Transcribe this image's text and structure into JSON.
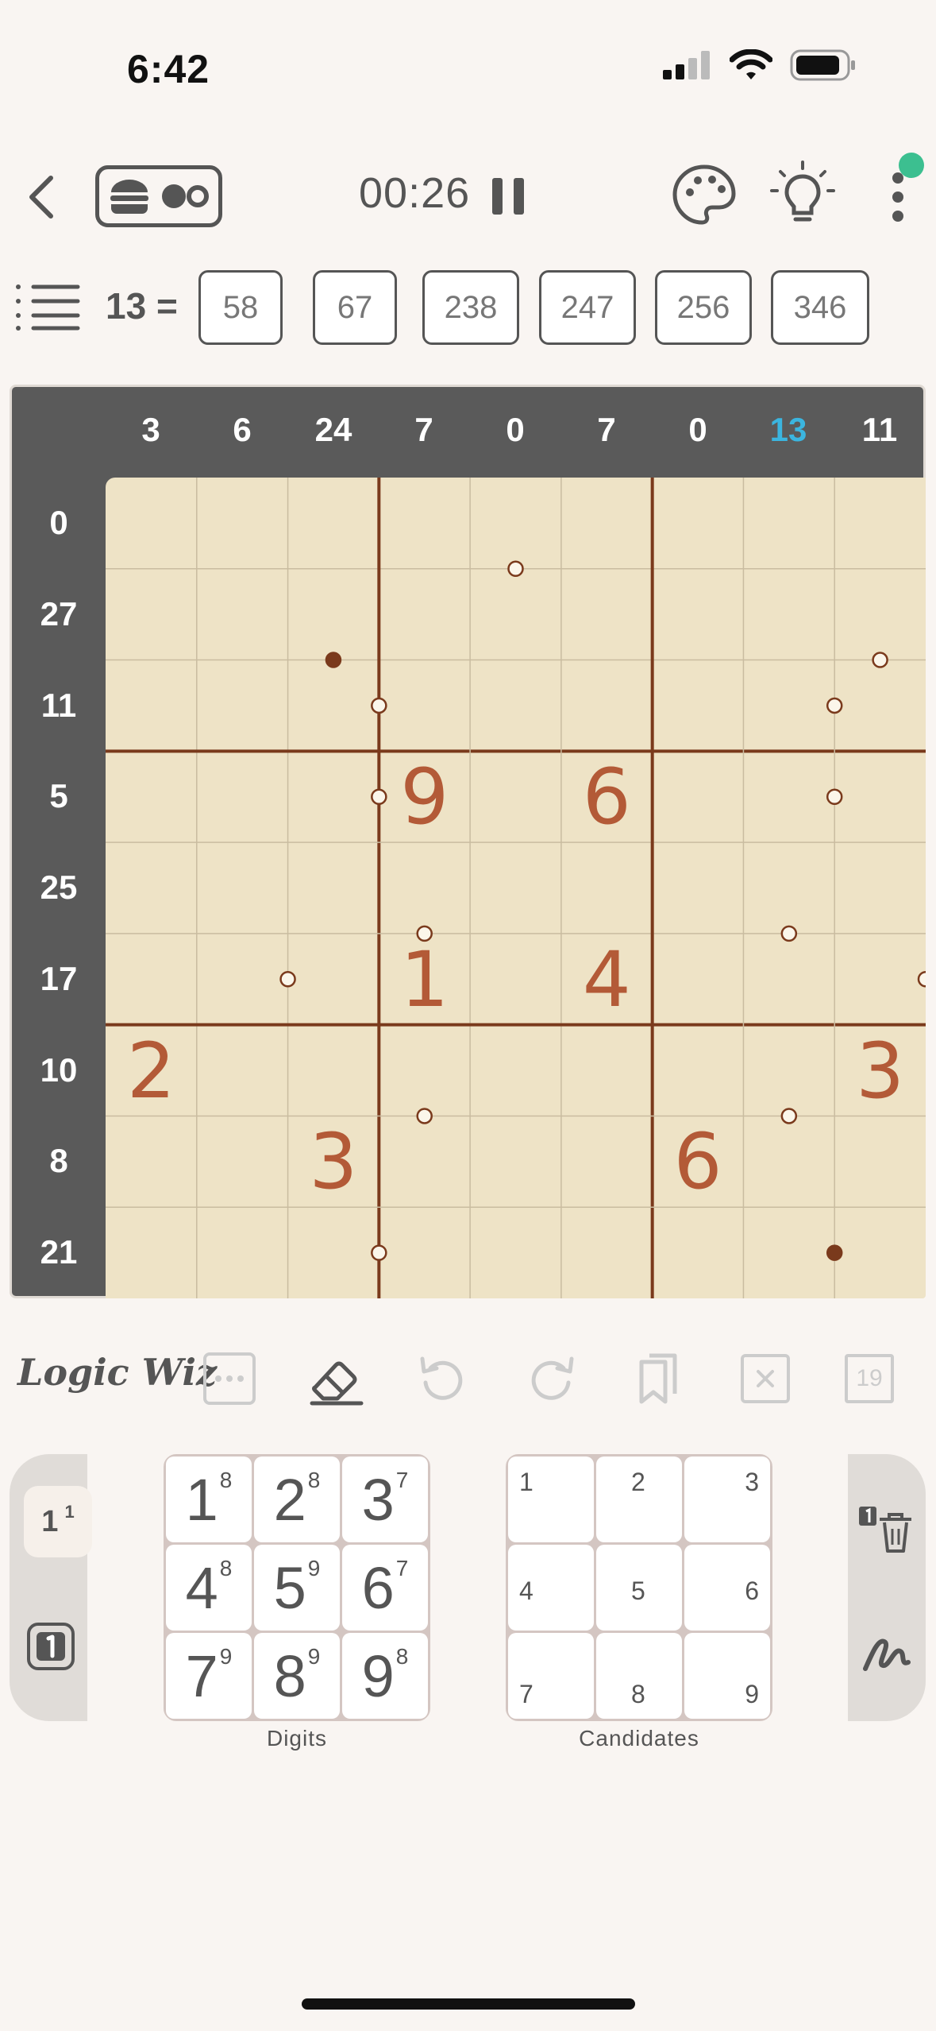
{
  "status": {
    "time": "6:42"
  },
  "header": {
    "timer": "00:26"
  },
  "sum_strip": {
    "label": "13 =",
    "combos": [
      "58",
      "67",
      "238",
      "247",
      "256",
      "346"
    ]
  },
  "board": {
    "col_clues": [
      "3",
      "6",
      "24",
      "7",
      "0",
      "7",
      "0",
      "13",
      "11"
    ],
    "row_clues": [
      "0",
      "27",
      "11",
      "5",
      "25",
      "17",
      "10",
      "8",
      "21"
    ],
    "highlight_col": 7,
    "givens": [
      {
        "row": 3,
        "col": 3,
        "value": "9"
      },
      {
        "row": 3,
        "col": 5,
        "value": "6"
      },
      {
        "row": 5,
        "col": 3,
        "value": "1"
      },
      {
        "row": 5,
        "col": 5,
        "value": "4"
      },
      {
        "row": 6,
        "col": 0,
        "value": "2"
      },
      {
        "row": 6,
        "col": 8,
        "value": "3"
      },
      {
        "row": 7,
        "col": 2,
        "value": "3"
      },
      {
        "row": 7,
        "col": 6,
        "value": "6"
      }
    ],
    "dots": [
      {
        "r": 1,
        "c": 4.5,
        "filled": false
      },
      {
        "r": 2,
        "c": 2.5,
        "filled": true
      },
      {
        "r": 2,
        "c": 8.5,
        "filled": false
      },
      {
        "r": 2.5,
        "c": 3,
        "filled": false
      },
      {
        "r": 2.5,
        "c": 8,
        "filled": false
      },
      {
        "r": 3.5,
        "c": 3,
        "filled": false
      },
      {
        "r": 3.5,
        "c": 8,
        "filled": false
      },
      {
        "r": 5,
        "c": 3.5,
        "filled": false
      },
      {
        "r": 5,
        "c": 7.5,
        "filled": false
      },
      {
        "r": 5.5,
        "c": 2,
        "filled": false
      },
      {
        "r": 5.5,
        "c": 9,
        "filled": false
      },
      {
        "r": 7,
        "c": 3.5,
        "filled": false
      },
      {
        "r": 7,
        "c": 7.5,
        "filled": false
      },
      {
        "r": 8.5,
        "c": 3,
        "filled": false
      },
      {
        "r": 8.5,
        "c": 8,
        "filled": true
      }
    ]
  },
  "toolbar": {
    "logo": "Logic Wiz",
    "counter": "19"
  },
  "left_pad": {
    "mode_label": "1",
    "mode_sup": "1"
  },
  "digits_pad": {
    "label": "Digits",
    "keys": [
      {
        "digit": "1",
        "count": "8"
      },
      {
        "digit": "2",
        "count": "8"
      },
      {
        "digit": "3",
        "count": "7"
      },
      {
        "digit": "4",
        "count": "8"
      },
      {
        "digit": "5",
        "count": "9"
      },
      {
        "digit": "6",
        "count": "7"
      },
      {
        "digit": "7",
        "count": "9"
      },
      {
        "digit": "8",
        "count": "9"
      },
      {
        "digit": "9",
        "count": "8"
      }
    ]
  },
  "candidates_pad": {
    "label": "Candidates",
    "keys": [
      "1",
      "2",
      "3",
      "4",
      "5",
      "6",
      "7",
      "8",
      "9"
    ]
  },
  "colors": {
    "accent": "#3bb5df",
    "given": "#b35a37",
    "grid_bg": "#eee3c6",
    "frame": "#5a5a5a",
    "notification": "#3cbf90"
  }
}
